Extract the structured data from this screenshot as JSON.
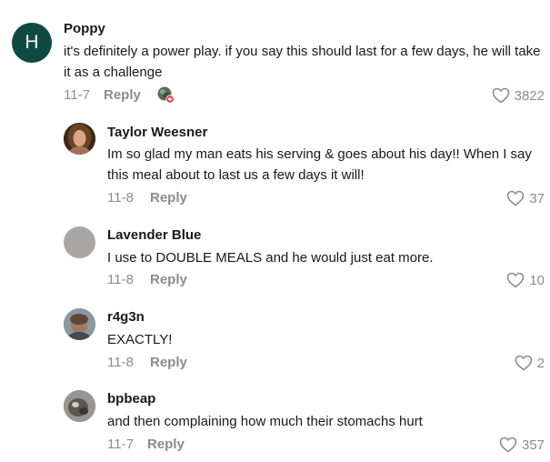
{
  "comments": [
    {
      "username": "Poppy",
      "avatar_letter": "H",
      "text": "it's definitely a power play. if you say this should last for a few days, he will take it as a challenge",
      "date": "11-7",
      "reply_label": "Reply",
      "likes": "3822",
      "creator_liked": true
    },
    {
      "username": "Taylor Weesner",
      "text": "Im so glad my man eats his serving & goes about his day!! When I say this meal about to last us a few days it will!",
      "date": "11-8",
      "reply_label": "Reply",
      "likes": "37"
    },
    {
      "username": "Lavender Blue",
      "text": "I use to DOUBLE MEALS and he would just eat more.",
      "date": "11-8",
      "reply_label": "Reply",
      "likes": "10"
    },
    {
      "username": "r4g3n",
      "text": "EXACTLY!",
      "date": "11-8",
      "reply_label": "Reply",
      "likes": "2"
    },
    {
      "username": "bpbeap",
      "text": "and then complaining how much their stomachs hurt",
      "date": "11-7",
      "reply_label": "Reply",
      "likes": "357"
    }
  ],
  "colors": {
    "avatar_h": "#0f4a42",
    "meta_gray": "#8a8b91",
    "text": "#161823"
  }
}
